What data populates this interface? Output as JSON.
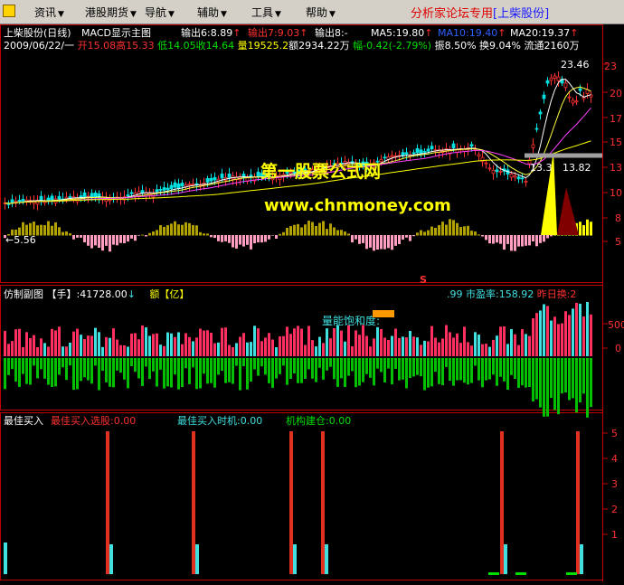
{
  "menu": {
    "items": [
      {
        "label": "资讯",
        "arrow": "▼"
      },
      {
        "label": "港股期货",
        "arrow": "▼"
      },
      {
        "label": "导航",
        "arrow": "▼"
      },
      {
        "label": "辅助",
        "arrow": "▼"
      },
      {
        "label": "工具",
        "arrow": "▼"
      },
      {
        "label": "帮助",
        "arrow": "▼"
      }
    ],
    "banner": "分析家论坛专用",
    "banner_tag": "[上柴股份]"
  },
  "main_panel": {
    "title": "上柴股份(日线)",
    "indicator": "MACD显示主图",
    "outputs": [
      {
        "label": "输出6:8.89",
        "arrow": "↑",
        "color": "#ffffff"
      },
      {
        "label": "输出7:9.03",
        "arrow": "↑",
        "color": "#ff3030"
      },
      {
        "label": "输出8:-",
        "arrow": "",
        "color": "#ffffff"
      },
      {
        "label": "MA5:19.80",
        "arrow": "↑",
        "color": "#ffffff"
      },
      {
        "label": "MA10:19.40",
        "arrow": "↑",
        "color": "#3060ff"
      },
      {
        "label": "MA20:19.37",
        "arrow": "↑",
        "color": "#ffffff"
      }
    ],
    "quote": {
      "date": "2009/06/22/一",
      "open": "开15.08",
      "high": "高15.33",
      "low": "低14.05",
      "close": "收14.64",
      "volume": "量19525.2",
      "amount": "额2934.22万",
      "change": "幅-0.42(-2.79%)",
      "amplitude": "振8.50%",
      "turnover": "换9.04%",
      "float": "流通2160万"
    },
    "watermark": "第一股票公式网",
    "watermark_url": "www.chnmoney.com",
    "label_high": "23.46",
    "label_mid_a": "13.3",
    "label_mid_b": "13.82",
    "label_low": "←5.56",
    "marker": "S",
    "y_axis": [
      "23",
      "20",
      "17",
      "15",
      "13",
      "10",
      "8",
      "5"
    ]
  },
  "sub_panel_1": {
    "title": "仿制副图",
    "hand_label": "【手】",
    "hand_value": ":41728.00",
    "hand_arrow": "↓",
    "amount_label": "额【亿】",
    "pe_prefix": ".99",
    "pe": "市盈率:158.92",
    "prev_turnover": "昨日换:2",
    "center_label": "量能饱和度:",
    "y_axis": [
      "500",
      "0"
    ]
  },
  "sub_panel_2": {
    "title": "最佳买入",
    "signal_1": "最佳买入选股:0.00",
    "signal_2": "最佳买入时机:0.00",
    "signal_3": "机构建仓:0.00",
    "y_axis": [
      "5",
      "4",
      "3",
      "2",
      "1"
    ]
  },
  "colors": {
    "up": "#ff3030",
    "down": "#00e0e0",
    "ma5": "#ffffff",
    "ma10": "#ffff40",
    "ma20": "#ff40ff",
    "ma_long": "#ffff00",
    "watermark": "#ffff00",
    "vol_green": "#00c000",
    "cyan": "#40e0e0",
    "frame": "#c00000"
  }
}
